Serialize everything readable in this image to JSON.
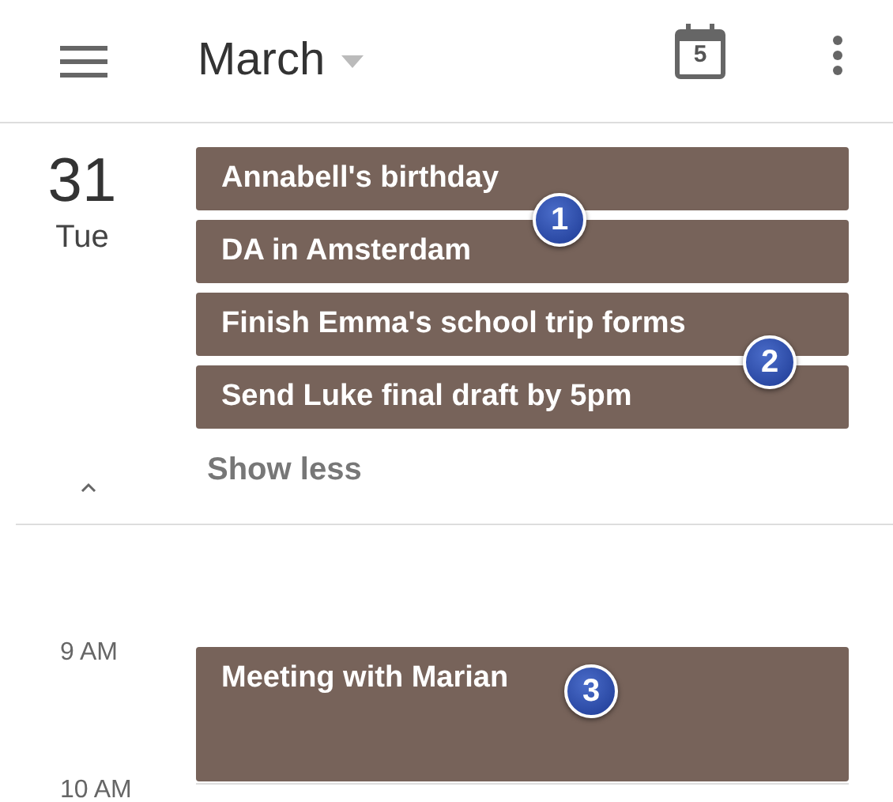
{
  "header": {
    "month": "March",
    "calendar_day": "5"
  },
  "day": {
    "date": "31",
    "weekday": "Tue",
    "toggle": "Show less",
    "events": [
      {
        "title": "Annabell's birthday"
      },
      {
        "title": "DA in Amsterdam"
      },
      {
        "title": "Finish Emma's school trip forms"
      },
      {
        "title": "Send Luke final draft by 5pm"
      }
    ]
  },
  "schedule": {
    "hours": [
      {
        "label": "9 AM"
      },
      {
        "label": "10 AM"
      }
    ],
    "events": [
      {
        "title": "Meeting with Marian"
      }
    ]
  },
  "callouts": [
    {
      "number": "1"
    },
    {
      "number": "2"
    },
    {
      "number": "3"
    }
  ]
}
